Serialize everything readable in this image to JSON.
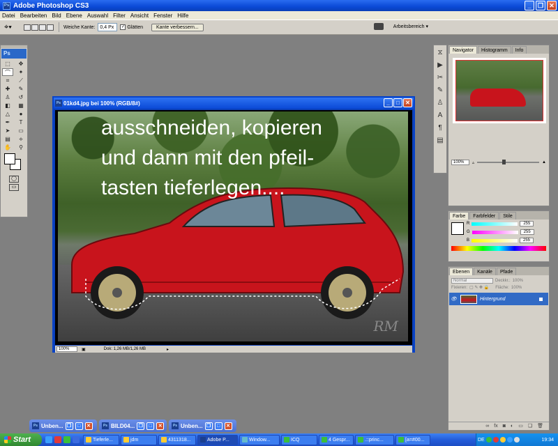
{
  "window": {
    "title": "Adobe Photoshop CS3",
    "app_badge": "Ps"
  },
  "menu": [
    "Datei",
    "Bearbeiten",
    "Bild",
    "Ebene",
    "Auswahl",
    "Filter",
    "Ansicht",
    "Fenster",
    "Hilfe"
  ],
  "options": {
    "feather_label": "Weiche Kante:",
    "feather_value": "0,4 Px",
    "smooth_label": "Glätten",
    "refine_button": "Kante verbessern...",
    "workspace_label": "Arbeitsbereich"
  },
  "tools": {
    "badge": "Ps"
  },
  "document": {
    "title": "01kd4.jpg bei 100% (RGB/8#)",
    "overlay_lines": [
      "ausschneiden, kopieren",
      "und dann mit den pfeil-",
      "tasten tieferlegen...."
    ],
    "signature": "RM",
    "zoom": "100%",
    "doc_info": "Dok: 1,26 MB/1,26 MB"
  },
  "navigator": {
    "tabs": [
      "Navigator",
      "Histogramm",
      "Info"
    ],
    "zoom": "100%"
  },
  "color_panel": {
    "tabs": [
      "Farbe",
      "Farbfelder",
      "Stile"
    ],
    "channels": [
      {
        "label": "R",
        "value": "255",
        "color": "#00cccc"
      },
      {
        "label": "G",
        "value": "255",
        "color": "#dd00dd"
      },
      {
        "label": "B",
        "value": "255",
        "color": "#dddd00"
      }
    ]
  },
  "layers_panel": {
    "tabs": [
      "Ebenen",
      "Kanäle",
      "Pfade"
    ],
    "blend_mode": "Normal",
    "opacity_label": "Deckkr.:",
    "fix_label": "Fixieren:",
    "fill_label": "Fläche:",
    "opacity_value": "100%",
    "fill_value": "100%",
    "layer_name": "Hintergrund"
  },
  "minimized_docs": [
    {
      "title": "Unben..."
    },
    {
      "title": "BILD04..."
    },
    {
      "title": "Unben..."
    }
  ],
  "taskbar": {
    "start": "Start",
    "items": [
      "Tieferle...",
      "jdm",
      "4311318...",
      "Adobe P...",
      "Window...",
      "ICQ",
      "4 Gespr...",
      ".::princ...",
      "[a=#00..."
    ],
    "active_index": 3,
    "lang": "DE",
    "clock": "19:34"
  }
}
